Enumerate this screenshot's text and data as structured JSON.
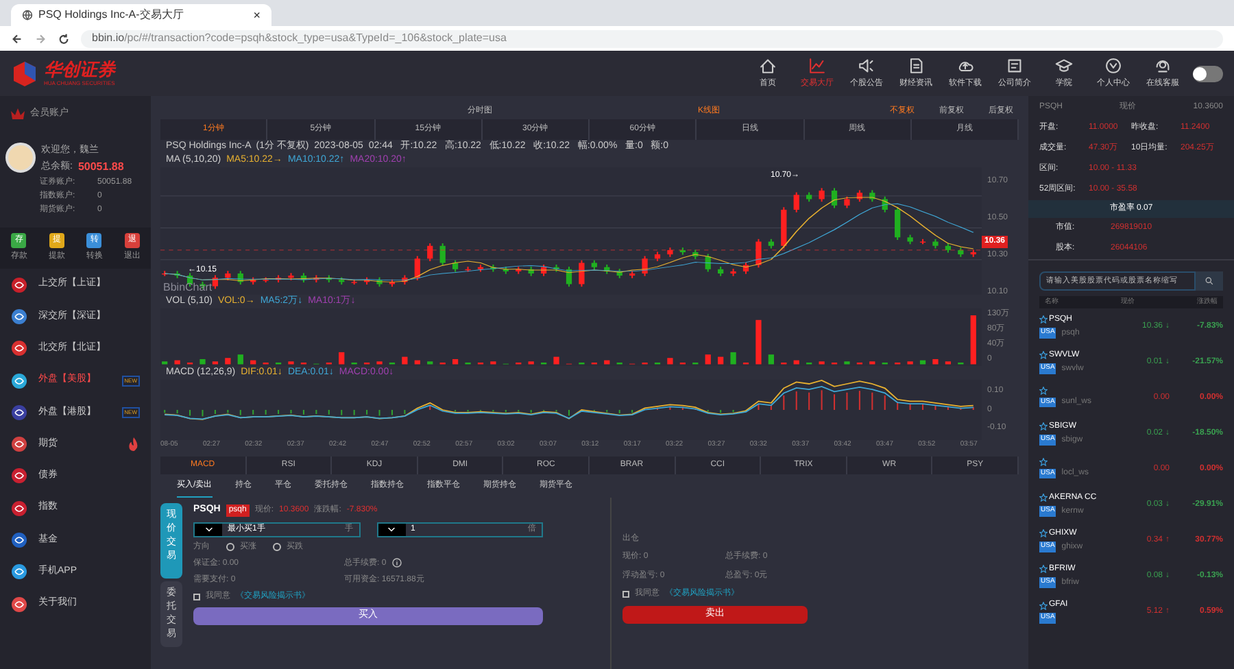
{
  "browser": {
    "tab_title": "PSQ Holdings Inc-A-交易大厅",
    "tab_close": "×",
    "url_host": "bbin.io",
    "url_path": "/pc/#/transaction?code=psqh&stock_type=usa&TypeId=_106&stock_plate=usa"
  },
  "header": {
    "logo": "华创证券",
    "logo_sub": "HUA CHUANG SECURITIES",
    "nav": [
      {
        "label": "首页",
        "selected": false
      },
      {
        "label": "交易大厅",
        "selected": true
      },
      {
        "label": "个股公告",
        "selected": false
      },
      {
        "label": "财经资讯",
        "selected": false
      },
      {
        "label": "软件下载",
        "selected": false
      },
      {
        "label": "公司简介",
        "selected": false
      },
      {
        "label": "学院",
        "selected": false
      },
      {
        "label": "个人中心",
        "selected": false
      },
      {
        "label": "在线客服",
        "selected": false
      }
    ],
    "theme_toggle": {
      "on": false
    }
  },
  "sidebar": {
    "title": "会员账户",
    "welcome": "欢迎您，魏兰",
    "total_label": "总余额:",
    "total": "50051.88",
    "accounts": [
      {
        "label": "证券账户:",
        "value": "50051.88"
      },
      {
        "label": "指数账户:",
        "value": "0"
      },
      {
        "label": "期货账户:",
        "value": "0"
      }
    ],
    "actions": [
      {
        "label": "存款",
        "glyph": "存",
        "color": "#3aa845"
      },
      {
        "label": "提款",
        "glyph": "提",
        "color": "#e0a81a"
      },
      {
        "label": "转换",
        "glyph": "转",
        "color": "#3b8fd9"
      },
      {
        "label": "退出",
        "glyph": "退",
        "color": "#d8403b"
      }
    ],
    "menu": [
      {
        "label": "上交所【上证】",
        "selected": false
      },
      {
        "label": "深交所【深证】",
        "selected": false
      },
      {
        "label": "北交所【北证】",
        "selected": false
      },
      {
        "label": "外盘【美股】",
        "selected": true,
        "badge": "NEW"
      },
      {
        "label": "外盘【港股】",
        "selected": false,
        "badge": "NEW"
      },
      {
        "label": "期货",
        "selected": false,
        "hot": true
      },
      {
        "label": "债券",
        "selected": false
      },
      {
        "label": "指数",
        "selected": false
      },
      {
        "label": "基金",
        "selected": false
      },
      {
        "label": "手机APP",
        "selected": false
      },
      {
        "label": "关于我们",
        "selected": false
      }
    ]
  },
  "chart_modes": [
    {
      "label": "分时图",
      "selected": false
    },
    {
      "label": "K线图",
      "selected": true
    }
  ],
  "adjust": [
    {
      "label": "不复权",
      "selected": true
    },
    {
      "label": "前复权",
      "selected": false
    },
    {
      "label": "后复权",
      "selected": false
    }
  ],
  "periods": [
    {
      "label": "1分钟",
      "selected": true
    },
    {
      "label": "5分钟",
      "selected": false
    },
    {
      "label": "15分钟",
      "selected": false
    },
    {
      "label": "30分钟",
      "selected": false
    },
    {
      "label": "60分钟",
      "selected": false
    },
    {
      "label": "日线",
      "selected": false
    },
    {
      "label": "周线",
      "selected": false
    },
    {
      "label": "月线",
      "selected": false
    }
  ],
  "info_line": "PSQ Holdings Inc-A  (1分 不复权)  2023-08-05  02:44   开:10.22   高:10.22   低:10.22   收:10.22   幅:0.00%   量:0   额:0",
  "ma_legend": [
    {
      "text": "MA (5,10,20)",
      "color": "#d0d0d0"
    },
    {
      "text": "MA5:10.22→",
      "color": "#e8b130"
    },
    {
      "text": "MA10:10.22↑",
      "color": "#3fa7d6"
    },
    {
      "text": "MA20:10.20↑",
      "color": "#a040b0"
    }
  ],
  "kline": {
    "yticks": [
      "10.70",
      "10.50",
      "10.30",
      "10.10"
    ],
    "high_label": "10.70→",
    "low_label": "←10.15",
    "last_price": "10.36",
    "brand": "BbinChart"
  },
  "vol_legend": [
    {
      "text": "VOL (5,10)",
      "color": "#d0d0d0"
    },
    {
      "text": "VOL:0→",
      "color": "#e8b130"
    },
    {
      "text": "MA5:2万↓",
      "color": "#3fa7d6"
    },
    {
      "text": "MA10:1万↓",
      "color": "#a040b0"
    }
  ],
  "vol": {
    "yticks": [
      "130万",
      "80万",
      "40万",
      "0"
    ]
  },
  "macd_legend": [
    {
      "text": "MACD (12,26,9)",
      "color": "#d0d0d0"
    },
    {
      "text": "DIF:0.01↓",
      "color": "#e8b130"
    },
    {
      "text": "DEA:0.01↓",
      "color": "#3fa7d6"
    },
    {
      "text": "MACD:0.00↓",
      "color": "#a040b0"
    }
  ],
  "macd": {
    "yticks": [
      "0.10",
      "0",
      "-0.10"
    ]
  },
  "xticks": [
    "08-05",
    "02:27",
    "02:32",
    "02:37",
    "02:42",
    "02:47",
    "02:52",
    "02:57",
    "03:02",
    "03:07",
    "03:12",
    "03:17",
    "03:22",
    "03:27",
    "03:32",
    "03:37",
    "03:42",
    "03:47",
    "03:52",
    "03:57"
  ],
  "indicators": [
    {
      "label": "MACD",
      "selected": true
    },
    {
      "label": "RSI",
      "selected": false
    },
    {
      "label": "KDJ",
      "selected": false
    },
    {
      "label": "DMI",
      "selected": false
    },
    {
      "label": "ROC",
      "selected": false
    },
    {
      "label": "BRAR",
      "selected": false
    },
    {
      "label": "CCI",
      "selected": false
    },
    {
      "label": "TRIX",
      "selected": false
    },
    {
      "label": "WR",
      "selected": false
    },
    {
      "label": "PSY",
      "selected": false
    }
  ],
  "trade_tabs": [
    {
      "label": "买入/卖出",
      "selected": true
    },
    {
      "label": "持仓",
      "selected": false
    },
    {
      "label": "平仓",
      "selected": false
    },
    {
      "label": "委托持仓",
      "selected": false
    },
    {
      "label": "指数持仓",
      "selected": false
    },
    {
      "label": "指数平仓",
      "selected": false
    },
    {
      "label": "期货持仓",
      "selected": false
    },
    {
      "label": "期货平仓",
      "selected": false
    }
  ],
  "trade_modes": [
    {
      "label": "现价交易",
      "selected": true
    },
    {
      "label": "委托交易",
      "selected": false
    }
  ],
  "order": {
    "symbol": "PSQH",
    "code": "psqh",
    "price_label": "现价:",
    "price": "10.3600",
    "change_label": "涨跌幅:",
    "change": "-7.830%",
    "lots": "最小买1手",
    "lots_unit": "手",
    "multiple": "1",
    "multiple_unit": "倍",
    "direction_label": "方向",
    "directions": [
      {
        "label": "买涨",
        "selected": false
      },
      {
        "label": "买跌",
        "selected": false
      }
    ],
    "margin": "保证金:  0.00",
    "fee": "总手续费:  0",
    "pay": "需要支付:  0",
    "available": "可用资金:  16571.88元",
    "agree": "我同意",
    "agree_checked": false,
    "agree_link": "《交易风险揭示书》",
    "buy": "买入"
  },
  "close": {
    "title": "出仓",
    "fields": [
      "现价:  0",
      "总手续费:  0",
      "浮动盈亏:  0",
      "总盈亏:  0元"
    ],
    "agree": "我同意",
    "agree_checked": false,
    "agree_link": "《交易风险揭示书》",
    "sell": "卖出"
  },
  "quote": {
    "symbol": "PSQH",
    "price_label": "现价",
    "price": "10.3600",
    "rows": [
      [
        {
          "label": "开盘:",
          "value": "11.0000"
        },
        {
          "label": "昨收盘:",
          "value": "11.2400"
        }
      ],
      [
        {
          "label": "成交量:",
          "value": "47.30万"
        },
        {
          "label": "10日均量:",
          "value": "204.25万"
        }
      ],
      [
        {
          "label": "区间:",
          "value": "10.00 - 11.33"
        }
      ],
      [
        {
          "label": "52周区间:",
          "value": "10.00 - 35.58"
        }
      ]
    ],
    "pe": "市盈率 0.07",
    "cap_label": "市值:",
    "cap": "269819010",
    "shares_label": "股本:",
    "shares": "26044106"
  },
  "search": {
    "placeholder": "请输入美股股票代码或股票名称缩写"
  },
  "watch_columns": [
    "名称",
    "现价",
    "涨跌幅"
  ],
  "watchlist": [
    {
      "symbol": "PSQH",
      "market": "USA",
      "code": "psqh",
      "price": "10.36",
      "arrow": "↓",
      "change": "-7.83%",
      "color": "#3aa050"
    },
    {
      "symbol": "SWVLW",
      "market": "USA",
      "code": "swvlw",
      "price": "0.01",
      "arrow": "↓",
      "change": "-21.57%",
      "color": "#3aa050"
    },
    {
      "market": "USA",
      "code": "sunl_ws",
      "price": "0.00",
      "change": "0.00%",
      "color": "#d03030"
    },
    {
      "symbol": "SBIGW",
      "market": "USA",
      "code": "sbigw",
      "price": "0.02",
      "arrow": "↓",
      "change": "-18.50%",
      "color": "#3aa050"
    },
    {
      "market": "USA",
      "code": "locl_ws",
      "price": "0.00",
      "change": "0.00%",
      "color": "#d03030"
    },
    {
      "symbol": "AKERNA CC",
      "market": "USA",
      "code": "kernw",
      "price": "0.03",
      "arrow": "↓",
      "change": "-29.91%",
      "color": "#3aa050"
    },
    {
      "symbol": "GHIXW",
      "market": "USA",
      "code": "ghixw",
      "price": "0.34",
      "arrow": "↑",
      "change": "30.77%",
      "color": "#d03030"
    },
    {
      "symbol": "BFRIW",
      "market": "USA",
      "code": "bfriw",
      "price": "0.08",
      "arrow": "↓",
      "change": "-0.13%",
      "color": "#3aa050"
    },
    {
      "symbol": "GFAI",
      "market": "USA",
      "price": "5.12",
      "arrow": "↑",
      "change": "0.59%",
      "color": "#d03030"
    }
  ]
}
